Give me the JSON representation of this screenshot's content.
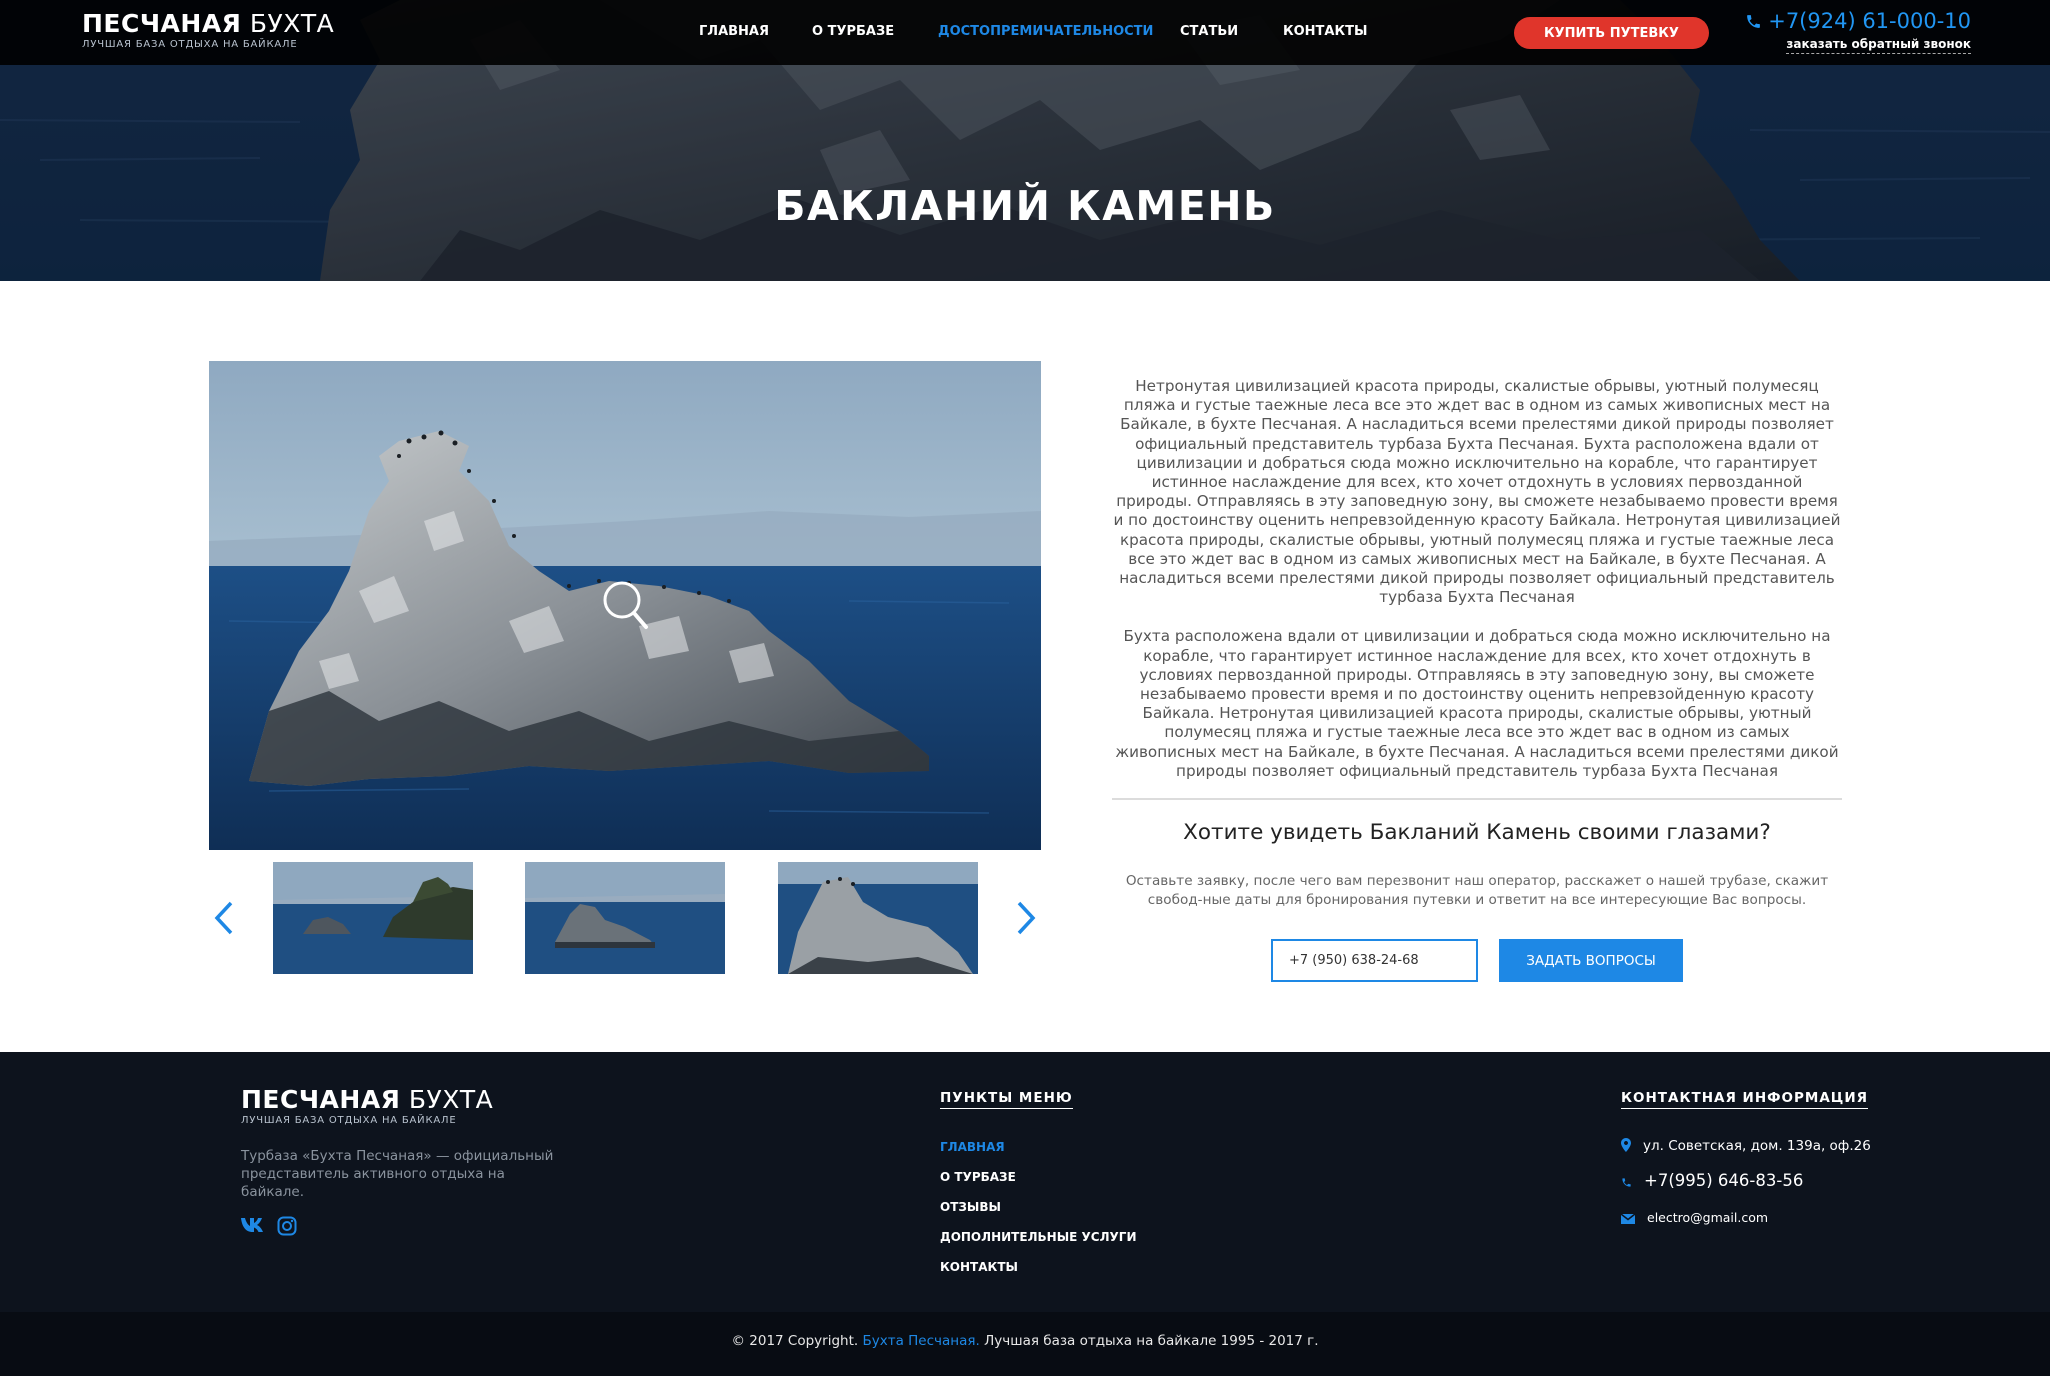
{
  "header": {
    "logo_bold": "ПЕСЧАНАЯ",
    "logo_light": "БУХТА",
    "logo_sub": "ЛУЧШАЯ БАЗА ОТДЫХА НА БАЙКАЛЕ",
    "nav": [
      "ГЛАВНАЯ",
      "О ТУРБАЗЕ",
      "ДОСТОПРЕМИЧАТЕЛЬНОСТИ",
      "СТАТЬИ",
      "КОНТАКТЫ"
    ],
    "active_nav": "ДОСТОПРЕМИЧАТЕЛЬНОСТИ",
    "buy_button": "КУПИТЬ ПУТЕВКУ",
    "phone": "+7(924) 61-000-10",
    "callback": "заказать обратный звонок"
  },
  "hero": {
    "title": "БАКЛАНИЙ КАМЕНЬ"
  },
  "content": {
    "paragraph1": "Нетронутая цивилизацией красота природы, скалистые обрывы, уютный полумесяц пляжа и густые таежные леса все это ждет вас в одном из самых живописных мест на Байкале, в бухте Песчаная. А насладиться всеми прелестями дикой природы позволяет официальный представитель турбаза Бухта Песчаная. Бухта расположена вдали от цивилизации и добраться сюда можно исключительно на корабле, что гарантирует истинное наслаждение для всех, кто хочет отдохнуть в условиях первозданной природы. Отправляясь в эту заповедную зону, вы сможете незабываемо провести время и по достоинству оценить непревзойденную красоту Байкала. Нетронутая цивилизацией красота природы, скалистые обрывы, уютный полумесяц пляжа и густые таежные леса все это ждет вас в одном из самых живописных мест на Байкале, в бухте Песчаная. А насладиться всеми прелестями дикой природы позволяет официальный представитель турбаза Бухта Песчаная",
    "paragraph2": "Бухта расположена вдали от цивилизации и добраться сюда можно исключительно на корабле, что гарантирует истинное наслаждение для всех, кто хочет отдохнуть в условиях первозданной природы. Отправляясь в эту заповедную зону, вы сможете незабываемо провести время и по достоинству оценить непревзойденную красоту Байкала. Нетронутая цивилизацией красота природы, скалистые обрывы, уютный полумесяц пляжа и густые таежные леса все это ждет вас в одном из самых живописных мест на Байкале, в бухте Песчаная. А насладиться всеми прелестями дикой природы позволяет официальный представитель турбаза Бухта Песчаная",
    "cta_title": "Хотите увидеть Бакланий Камень своими глазами?",
    "cta_text": "Оставьте заявку, после чего вам перезвонит наш оператор, расскажет о нашей трубазе, скажит свобод-ные даты для бронирования путевки и ответит на все интересующие Вас вопросы.",
    "phone_value": "+7 (950) 638-24-68",
    "ask_button": "ЗАДАТЬ ВОПРОСЫ"
  },
  "footer": {
    "logo_bold": "ПЕСЧАНАЯ",
    "logo_light": "БУХТА",
    "logo_sub": "ЛУЧШАЯ БАЗА ОТДЫХА НА БАЙКАЛЕ",
    "about": "Турбаза «Бухта Песчаная» — официальный представитель активного отдыха на байкале.",
    "menu_heading": "ПУНКТЫ МЕНЮ",
    "menu": [
      "ГЛАВНАЯ",
      "О ТУРБАЗЕ",
      "ОТЗЫВЫ",
      "ДОПОЛНИТЕЛЬНЫЕ УСЛУГИ",
      "КОНТАКТЫ"
    ],
    "contacts_heading": "КОНТАКТНАЯ ИНФОРМАЦИЯ",
    "address": "ул. Советская, дом. 139а, оф.26",
    "phone": "+7(995) 646-83-56",
    "email": "electro@gmail.com",
    "copyright_prefix": "© 2017 Copyright.",
    "copyright_brand": "Бухта Песчаная.",
    "copyright_suffix": "Лучшая база отдыха на байкале 1995 - 2017 г."
  },
  "colors": {
    "accent_blue": "#1e88e5",
    "cta_red": "#e0352b",
    "footer_bg": "#0d131d"
  },
  "icons": [
    "phone-icon",
    "search-zoom-icon",
    "chevron-left-icon",
    "chevron-right-icon",
    "vk-icon",
    "instagram-icon",
    "map-pin-icon",
    "envelope-icon"
  ]
}
